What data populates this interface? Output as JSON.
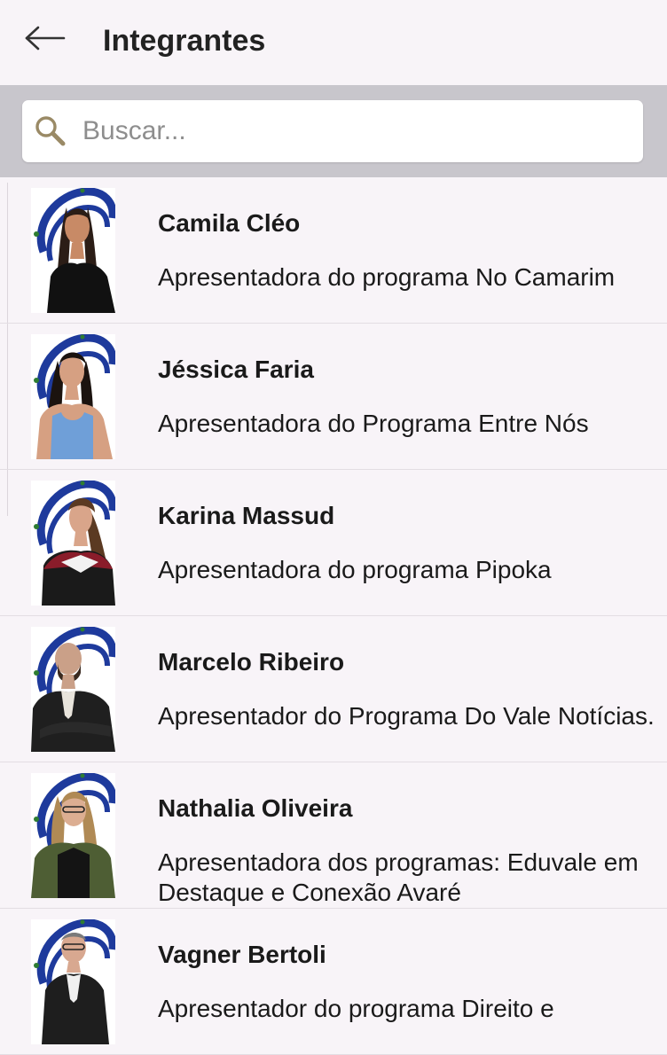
{
  "header": {
    "title": "Integrantes",
    "back_icon": "arrow-left-icon"
  },
  "search": {
    "placeholder": "Buscar...",
    "value": "",
    "icon": "search-icon"
  },
  "colors": {
    "background": "#f8f4f8",
    "search_band": "#c8c6cc",
    "logo_blue": "#1e3a9c",
    "logo_green": "#2e7d32"
  },
  "members": [
    {
      "name": "Camila Cléo",
      "role": "Apresentadora do programa No Camarim",
      "photo": "person-photo-woman-black-dress"
    },
    {
      "name": "Jéssica Faria",
      "role": "Apresentadora do Programa Entre Nós",
      "photo": "person-photo-woman-blue-top"
    },
    {
      "name": "Karina Massud",
      "role": "Apresentadora do programa Pipoka",
      "photo": "person-photo-woman-red-white-top"
    },
    {
      "name": "Marcelo Ribeiro",
      "role": "Apresentador do Programa Do Vale Notícias.",
      "photo": "person-photo-man-suit"
    },
    {
      "name": "Nathalia Oliveira",
      "role": "Apresentadora dos programas: Eduvale em Destaque e Conexão Avaré",
      "photo": "person-photo-woman-green-jacket"
    },
    {
      "name": "Vagner Bertoli",
      "role": "Apresentador do programa Direito e",
      "photo": "person-photo-man-glasses-suit"
    }
  ]
}
